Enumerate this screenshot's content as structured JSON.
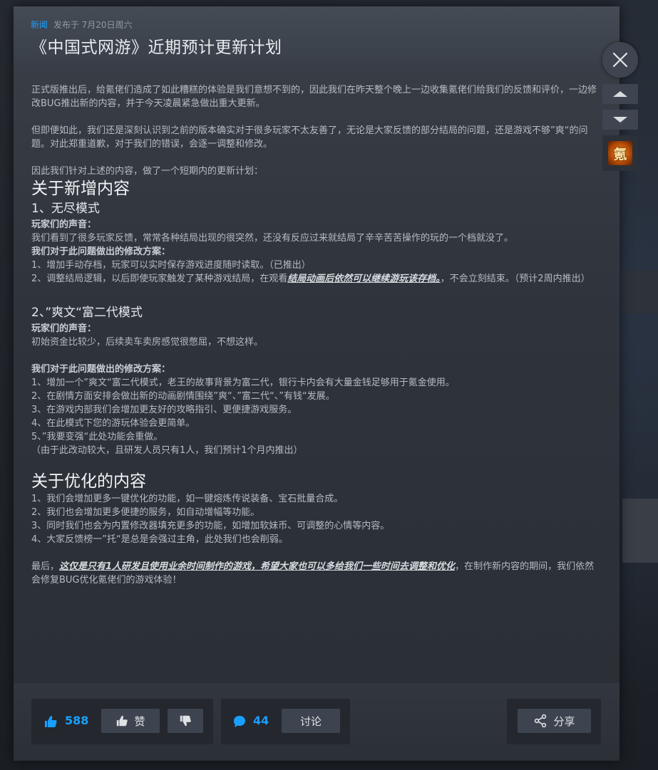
{
  "header": {
    "tag": "新闻",
    "posted": "发布于 7月20日周六",
    "title": "《中国式网游》近期预计更新计划"
  },
  "body": {
    "intro1": "正式版推出后，给氪佬们造成了如此糟糕的体验是我们意想不到的，因此我们在昨天整个晚上一边收集氪佬们给我们的反馈和评价，一边修改BUG推出新的内容，并于今天凌晨紧急做出重大更新。",
    "intro2": "但即便如此，我们还是深刻认识到之前的版本确实对于很多玩家不太友善了，无论是大家反馈的部分结局的问题，还是游戏不够”爽“的问题。对此郑重道歉，对于我们的错误，会逐一调整和修改。",
    "intro3": "因此我们针对上述的内容，做了一个短期内的更新计划：",
    "section1_title": "关于新增内容",
    "sub1_title": "1、无尽模式",
    "sub1_voice_label": "玩家们的声音：",
    "sub1_voice": "我们看到了很多玩家反馈，常常各种结局出现的很突然，还没有反应过来就结局了辛辛苦苦操作的玩的一个档就没了。",
    "sub1_plan_label": "我们对于此问题做出的修改方案：",
    "sub1_item1": "1、增加手动存档，玩家可以实时保存游戏进度随时读取。（已推出）",
    "sub1_item2_pre": "2、调整结局逻辑，以后即使玩家触发了某种游戏结局，在观看",
    "sub1_item2_emph": "结局动画后依然可以继续游玩该存档。",
    "sub1_item2_post": "，不会立刻结束。（预计2周内推出）",
    "sub2_title": "2、”爽文“富二代模式",
    "sub2_voice_label": "玩家们的声音：",
    "sub2_voice": "初始资金比较少，后续卖车卖房感觉很憋屈，不想这样。",
    "sub2_plan_label": "我们对于此问题做出的修改方案：",
    "sub2_item1": "1、增加一个”爽文“富二代模式，老王的故事背景为富二代，银行卡内会有大量金钱足够用于氪金使用。",
    "sub2_item2": "2、在剧情方面安排会做出新的动画剧情围绕”爽“、”富二代“、”有钱“发展。",
    "sub2_item3": "3、在游戏内部我们会增加更友好的攻略指引、更便捷游戏服务。",
    "sub2_item4": "4、在此模式下您的游玩体验会更简单。",
    "sub2_item5": "5、”我要变强“此处功能会重做。",
    "sub2_note": "（由于此改动较大，且研发人员只有1人，我们预计1个月内推出）",
    "section2_title": "关于优化的内容",
    "opt_item1": "1、我们会增加更多一键优化的功能，如一键熔炼传说装备、宝石批量合成。",
    "opt_item2": "2、我们也会增加更多便捷的服务，如自动增幅等功能。",
    "opt_item3": "3、同时我们也会为内置修改器填充更多的功能，如增加软妹币、可调整的心情等内容。",
    "opt_item4": "4、大家反馈榜一”托“是总是会强过主角，此处我们也会削弱。",
    "final_pre": "最后，",
    "final_emph": "这仅是只有1人研发且使用业余时间制作的游戏，希望大家也可以多给我们一些时间去调整和优化",
    "final_post": "，在制作新内容的期间，我们依然会修复BUG优化氪佬们的游戏体验！"
  },
  "footer": {
    "like_count": "588",
    "like_label": "赞",
    "comment_count": "44",
    "discuss_label": "讨论",
    "share_label": "分享"
  },
  "side": {
    "app_glyph": "氪"
  },
  "colors": {
    "accent": "#1a9fff",
    "background": "#1e2127",
    "panel": "#24282e",
    "button": "#3d4450"
  },
  "icons": [
    "close-icon",
    "chevron-up-icon",
    "chevron-down-icon",
    "thumbs-up-icon",
    "thumbs-down-icon",
    "comment-icon",
    "share-icon"
  ]
}
